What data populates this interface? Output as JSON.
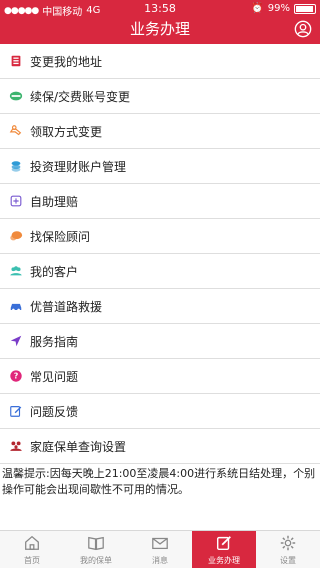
{
  "status_bar": {
    "carrier": "中国移动",
    "network": "4G",
    "time": "13:58",
    "battery": "99%"
  },
  "header": {
    "title": "业务办理"
  },
  "menu": [
    {
      "label": "变更我的地址",
      "icon": "address-book-icon",
      "color": "#d8283f"
    },
    {
      "label": "续保/交费账号变更",
      "icon": "card-icon",
      "color": "#3cb46e"
    },
    {
      "label": "领取方式变更",
      "icon": "hand-coin-icon",
      "color": "#f08a3c"
    },
    {
      "label": "投资理财账户管理",
      "icon": "coins-icon",
      "color": "#2f9bd6"
    },
    {
      "label": "自助理赔",
      "icon": "plus-square-icon",
      "color": "#7a5bd1"
    },
    {
      "label": "找保险顾问",
      "icon": "chat-bubble-icon",
      "color": "#f08a3c"
    },
    {
      "label": "我的客户",
      "icon": "users-icon",
      "color": "#3bbfb0"
    },
    {
      "label": "优普道路救援",
      "icon": "car-icon",
      "color": "#3a6fd8"
    },
    {
      "label": "服务指南",
      "icon": "navigation-arrow-icon",
      "color": "#7a3cc8"
    },
    {
      "label": "常见问题",
      "icon": "question-icon",
      "color": "#e0267a"
    },
    {
      "label": "问题反馈",
      "icon": "edit-icon",
      "color": "#3a6fd8"
    },
    {
      "label": "家庭保单查询设置",
      "icon": "family-icon",
      "color": "#b3262f"
    }
  ],
  "notice": "温馨提示:因每天晚上21:00至凌晨4:00进行系统日结处理，个别操作可能会出现间歇性不可用的情况。",
  "tabs": [
    {
      "label": "首页",
      "icon": "home-icon",
      "active": false
    },
    {
      "label": "我的保单",
      "icon": "book-icon",
      "active": false
    },
    {
      "label": "消息",
      "icon": "mail-icon",
      "active": false
    },
    {
      "label": "业务办理",
      "icon": "edit-icon",
      "active": true
    },
    {
      "label": "设置",
      "icon": "gear-icon",
      "active": false
    }
  ],
  "colors": {
    "brand": "#d8283f",
    "background": "#f2f2f2",
    "divider": "#dedede"
  }
}
